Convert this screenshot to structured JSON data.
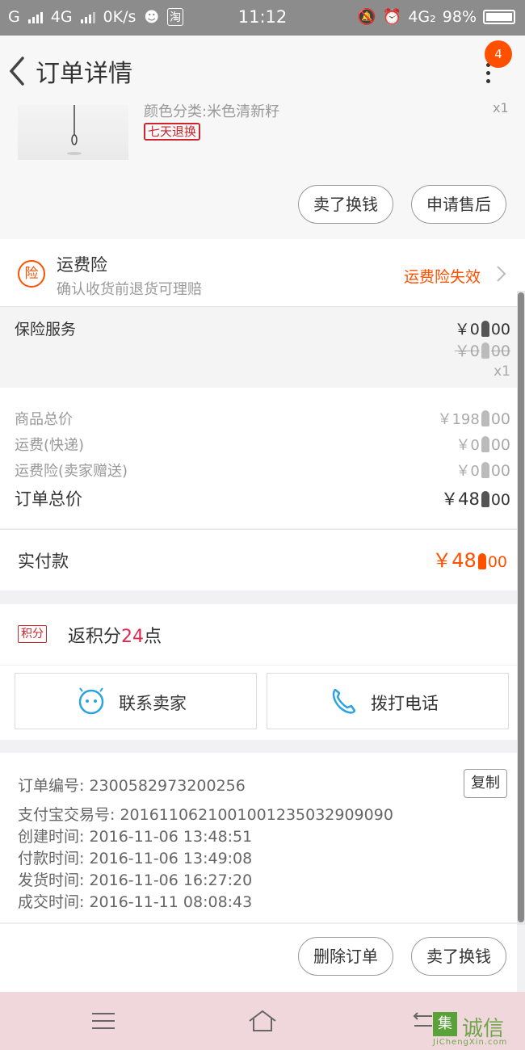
{
  "status_bar": {
    "carrier1": "G",
    "carrier2": "4G",
    "speed": "0K/s",
    "app_badge": "淘",
    "time": "11:12",
    "network": "4G₂",
    "battery": "98%"
  },
  "header": {
    "title": "订单详情",
    "notification_count": "4"
  },
  "product": {
    "sku": "颜色分类:米色清新籽",
    "qty": "x1",
    "tag": "七天退换",
    "buttons": [
      "卖了换钱",
      "申请售后"
    ]
  },
  "insurance": {
    "badge": "险",
    "title": "运费险",
    "subtitle": "确认收货前退货可理赔",
    "status": "运费险失效"
  },
  "service": {
    "label": "保险服务",
    "price_int": "￥0",
    "price_dec": "00",
    "orig_int": "￥0",
    "orig_dec": "00",
    "qty": "x1"
  },
  "totals": [
    {
      "label": "商品总价",
      "int": "￥198",
      "dec": "00"
    },
    {
      "label": "运费(快递)",
      "int": "￥0",
      "dec": "00"
    },
    {
      "label": "运费险(卖家赠送)",
      "int": "￥0",
      "dec": "00"
    },
    {
      "label": "订单总价",
      "int": "￥48",
      "dec": "00"
    }
  ],
  "paid": {
    "label": "实付款",
    "int": "￥48",
    "dec": "00"
  },
  "points": {
    "tag": "积分",
    "prefix": "返积分",
    "value": "24",
    "suffix": "点"
  },
  "actions": {
    "contact": "联系卖家",
    "call": "拨打电话"
  },
  "order_info": {
    "copy": "复制",
    "rows": [
      "订单编号: 2300582973200256",
      "支付宝交易号: 2016110621001001235032909090",
      "创建时间: 2016-11-06  13:48:51",
      "付款时间: 2016-11-06  13:49:08",
      "发货时间: 2016-11-06  16:27:20",
      "成交时间: 2016-11-11  08:08:43"
    ]
  },
  "bottom_actions": [
    "删除订单",
    "卖了换钱"
  ],
  "watermark": {
    "box": "集",
    "text": "诚信",
    "url": "JiChengXin.com"
  }
}
